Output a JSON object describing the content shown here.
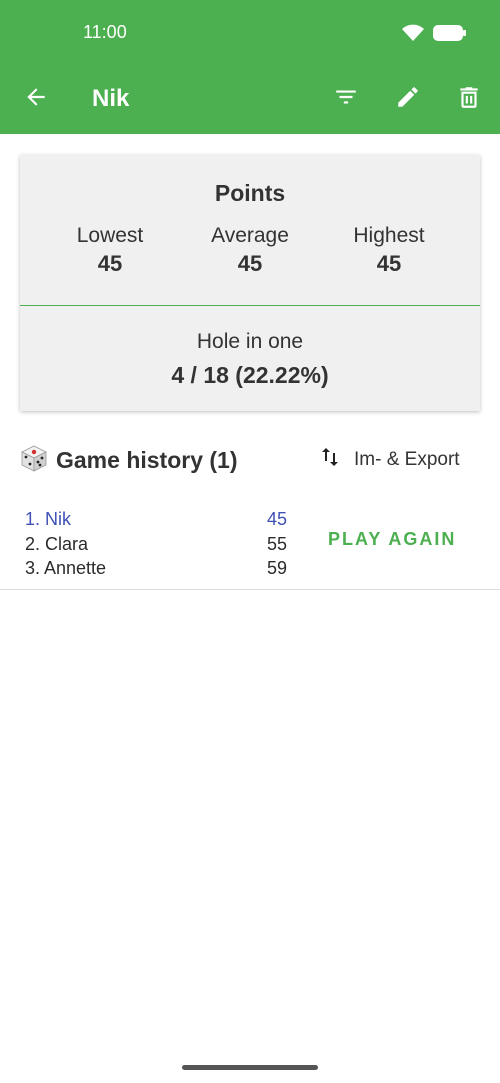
{
  "status_bar": {
    "time": "11:00",
    "icons": [
      "wifi-icon",
      "battery-icon"
    ]
  },
  "app_bar": {
    "title": "Nik",
    "icons": [
      "back-arrow-icon",
      "filter-icon",
      "edit-pencil-icon",
      "delete-trash-icon"
    ],
    "color": "#4caf50"
  },
  "stats": {
    "title": "Points",
    "lowest_label": "Lowest",
    "lowest_value": "45",
    "average_label": "Average",
    "average_value": "45",
    "highest_label": "Highest",
    "highest_value": "45",
    "hole_in_one_label": "Hole in one",
    "hole_in_one_value": "4 / 18 (22.22%)"
  },
  "history": {
    "title": "Game history (1)",
    "icon": "dice-icon",
    "export_label": "Im- & Export",
    "export_icon": "swap-vertical-icon"
  },
  "games": [
    {
      "players": [
        {
          "rank_name": "1. Nik",
          "score": "45",
          "winner": true
        },
        {
          "rank_name": "2. Clara",
          "score": "55",
          "winner": false
        },
        {
          "rank_name": "3. Annette",
          "score": "59",
          "winner": false
        }
      ],
      "action_label": "PLAY AGAIN"
    }
  ],
  "colors": {
    "accent": "#4caf50",
    "winner": "#3f51b5"
  }
}
